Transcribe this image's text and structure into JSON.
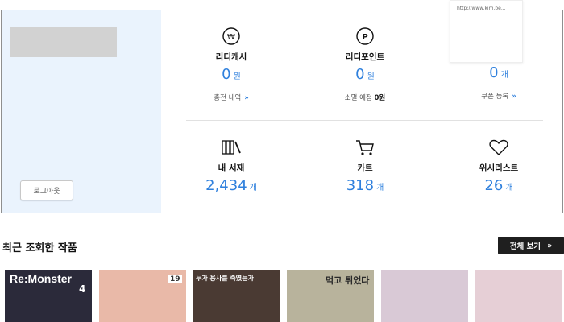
{
  "account": {
    "logout_label": "로그아웃"
  },
  "tooltip": {
    "url": "http://www.kim.be..."
  },
  "stats_top": [
    {
      "icon": "won-circle-icon",
      "label": "리디캐시",
      "value": "0",
      "unit": "원",
      "sub_text": "충전 내역",
      "sub_bold": "",
      "sub_arrow": "»"
    },
    {
      "icon": "point-circle-icon",
      "label": "리디포인트",
      "value": "0",
      "unit": "원",
      "sub_text": "소멸 예정",
      "sub_bold": "0원",
      "sub_arrow": ""
    },
    {
      "icon": "arrow-circle-icon",
      "label": "",
      "value": "0",
      "unit": "개",
      "sub_text": "쿠폰 등록",
      "sub_bold": "",
      "sub_arrow": "»"
    }
  ],
  "stats_bottom": [
    {
      "icon": "bookshelf-icon",
      "label": "내 서재",
      "value": "2,434",
      "unit": "개"
    },
    {
      "icon": "cart-icon",
      "label": "카트",
      "value": "318",
      "unit": "개"
    },
    {
      "icon": "heart-icon",
      "label": "위시리스트",
      "value": "26",
      "unit": "개"
    }
  ],
  "recent": {
    "title": "최근 조회한 작품",
    "view_all": "전체 보기",
    "view_all_chevron": "»",
    "covers": [
      {
        "title_text": "Re:Monster",
        "sub_text": "4",
        "bg": "#2b2a3a"
      },
      {
        "title_text": "19",
        "sub_text": "",
        "bg": "#e9b9a8"
      },
      {
        "title_text": "누가 용사를 죽였는가",
        "sub_text": "",
        "bg": "#4a3a33"
      },
      {
        "title_text": "먹고 튀었다",
        "sub_text": "",
        "bg": "#b8b39c"
      },
      {
        "title_text": "",
        "sub_text": "",
        "bg": "#d9c9d6"
      },
      {
        "title_text": "",
        "sub_text": "",
        "bg": "#e6cfd6"
      }
    ]
  },
  "colors": {
    "accent": "#2f80dd",
    "side_bg": "#eaf3fd"
  }
}
